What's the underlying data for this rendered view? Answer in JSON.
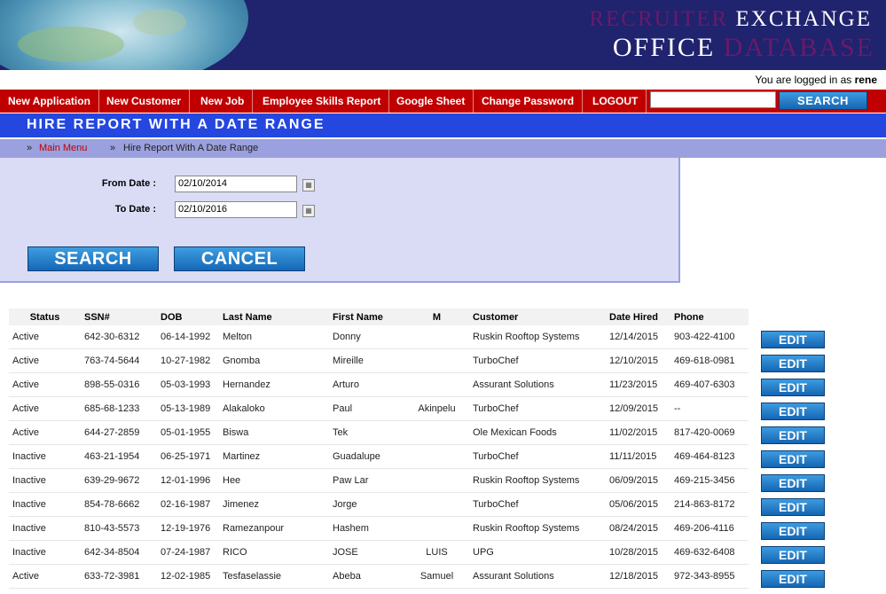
{
  "brand": {
    "line1_part1": "RECRUITER",
    "line1_part2": "EXCHANGE",
    "line2_part1": "OFFICE",
    "line2_part2": "DATABASE"
  },
  "login": {
    "prefix": "You are logged in as",
    "user": "rene"
  },
  "nav": {
    "items": [
      "New Application",
      "New Customer",
      "New Job",
      "Employee Skills Report",
      "Google Sheet",
      "Change Password",
      "LOGOUT"
    ],
    "search_value": "",
    "search_button": "SEARCH"
  },
  "page_title": "HIRE REPORT WITH A DATE RANGE",
  "breadcrumb": {
    "separator": "»",
    "main": "Main Menu",
    "current": "Hire Report With A Date Range"
  },
  "form": {
    "from_label": "From Date :",
    "from_value": "02/10/2014",
    "to_label": "To Date :",
    "to_value": "02/10/2016",
    "calendar_icon": "calendar-icon",
    "search_button": "SEARCH",
    "cancel_button": "CANCEL"
  },
  "table": {
    "headers": [
      "Status",
      "SSN#",
      "DOB",
      "Last Name",
      "First Name",
      "M",
      "Customer",
      "Date Hired",
      "Phone"
    ],
    "edit_label": "EDIT",
    "colors": {
      "active": "#1a8a1a",
      "inactive": "#cc0000"
    },
    "rows": [
      [
        "Active",
        "642-30-6312",
        "06-14-1992",
        "Melton",
        "Donny",
        "",
        "Ruskin Rooftop Systems",
        "12/14/2015",
        "903-422-4100"
      ],
      [
        "Active",
        "763-74-5644",
        "10-27-1982",
        "Gnomba",
        "Mireille",
        "",
        "TurboChef",
        "12/10/2015",
        "469-618-0981"
      ],
      [
        "Active",
        "898-55-0316",
        "05-03-1993",
        "Hernandez",
        "Arturo",
        "",
        "Assurant Solutions",
        "11/23/2015",
        "469-407-6303"
      ],
      [
        "Active",
        "685-68-1233",
        "05-13-1989",
        "Alakaloko",
        "Paul",
        "Akinpelu",
        "TurboChef",
        "12/09/2015",
        "--"
      ],
      [
        "Active",
        "644-27-2859",
        "05-01-1955",
        "Biswa",
        "Tek",
        "",
        "Ole Mexican Foods",
        "11/02/2015",
        "817-420-0069"
      ],
      [
        "Inactive",
        "463-21-1954",
        "06-25-1971",
        "Martinez",
        "Guadalupe",
        "",
        "TurboChef",
        "11/11/2015",
        "469-464-8123"
      ],
      [
        "Inactive",
        "639-29-9672",
        "12-01-1996",
        "Hee",
        "Paw Lar",
        "",
        "Ruskin Rooftop Systems",
        "06/09/2015",
        "469-215-3456"
      ],
      [
        "Inactive",
        "854-78-6662",
        "02-16-1987",
        "Jimenez",
        "Jorge",
        "",
        "TurboChef",
        "05/06/2015",
        "214-863-8172"
      ],
      [
        "Inactive",
        "810-43-5573",
        "12-19-1976",
        "Ramezanpour",
        "Hashem",
        "",
        "Ruskin Rooftop Systems",
        "08/24/2015",
        "469-206-4116"
      ],
      [
        "Inactive",
        "642-34-8504",
        "07-24-1987",
        "RICO",
        "JOSE",
        "LUIS",
        "UPG",
        "10/28/2015",
        "469-632-6408"
      ],
      [
        "Active",
        "633-72-3981",
        "12-02-1985",
        "Tesfaselassie",
        "Abeba",
        "Samuel",
        "Assurant Solutions",
        "12/18/2015",
        "972-343-8955"
      ]
    ]
  }
}
